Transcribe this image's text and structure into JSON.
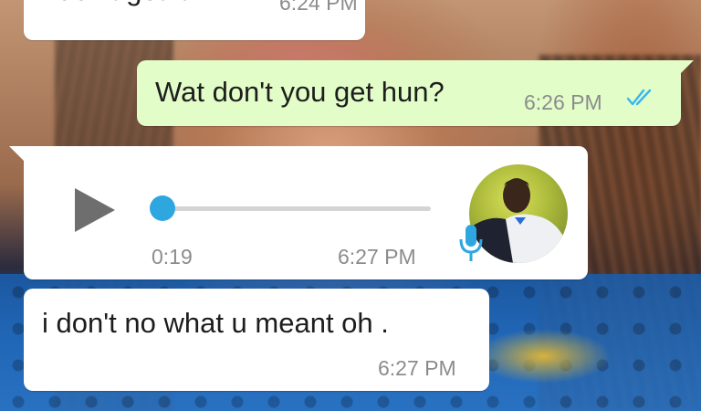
{
  "messages": [
    {
      "direction": "incoming",
      "text": "I don't get it",
      "time": "6:24 PM"
    },
    {
      "direction": "outgoing",
      "text": "Wat don't you get hun?",
      "time": "6:26 PM",
      "status": "read"
    },
    {
      "direction": "incoming",
      "type": "voice_note",
      "duration": "0:19",
      "time": "6:27 PM",
      "progress": 0.0
    },
    {
      "direction": "incoming",
      "text": "i don't no what u meant oh .",
      "time": "6:27 PM"
    }
  ],
  "icons": {
    "play": "play-icon",
    "read_receipt": "double-check-icon",
    "mic": "microphone-icon"
  },
  "colors": {
    "incoming_bubble": "#ffffff",
    "outgoing_bubble": "#e2fdc8",
    "accent": "#2ea7e0",
    "timestamp": "#8c8c8c"
  }
}
